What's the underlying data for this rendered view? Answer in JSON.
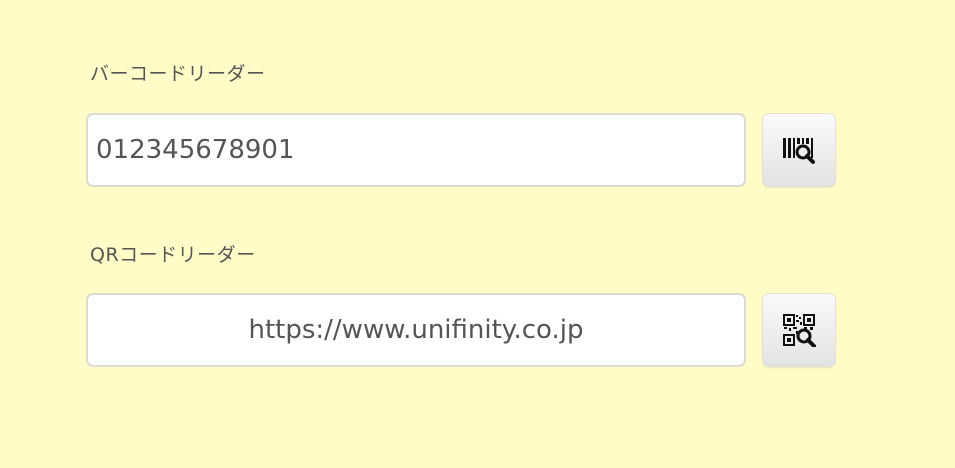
{
  "barcode": {
    "label": "バーコードリーダー",
    "value": "012345678901",
    "button_icon": "barcode-scan-icon"
  },
  "qrcode": {
    "label": "QRコードリーダー",
    "value": "https://www.unifinity.co.jp",
    "button_icon": "qrcode-scan-icon"
  },
  "colors": {
    "background": "#fffcc8",
    "input_border": "#dcdcd2",
    "text": "#555555",
    "icon": "#111111"
  }
}
